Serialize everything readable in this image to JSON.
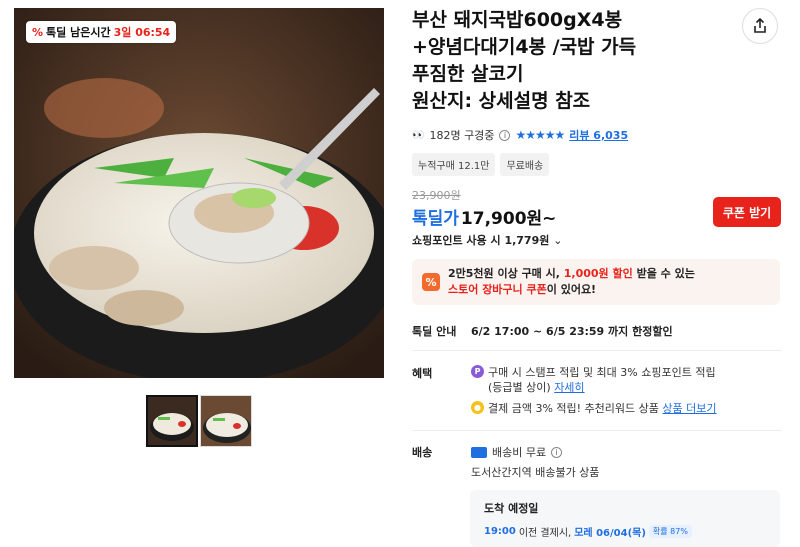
{
  "gallery": {
    "deal_tag_icon": "percent-icon",
    "deal_tag_label": "톡딜 남은시간",
    "deal_tag_time": "3일 06:54"
  },
  "product": {
    "title_lines": [
      "부산 돼지국밥600gX4봉",
      "+양념다대기4봉 /국밥 가득",
      "푸짐한 살코기",
      "원산지: 상세설명 참조"
    ],
    "viewers": "182명 구경중",
    "review_label": "리뷰 6,035",
    "rating_stars": 5,
    "chips": [
      "누적구매 12.1만",
      "무료배송"
    ],
    "original_price": "23,900원",
    "price_label": "톡딜가",
    "price": "17,900원~",
    "coupon_button": "쿠폰 받기",
    "points": "쇼핑포인트 사용 시 1,779원"
  },
  "promo": {
    "icon": "%",
    "line1_a": "2만5천원 이상 구매 시, ",
    "line1_red": "1,000원 할인",
    "line1_b": " 받을 수 있는",
    "line2_red": "스토어 장바구니 쿠폰",
    "line2_b": "이 있어요!"
  },
  "deal_info": {
    "label": "톡딜 안내",
    "value": "6/2 17:00 ~ 6/5 23:59 까지 한정할인"
  },
  "benefit": {
    "label": "혜택",
    "line1": "구매 시 스탬프 적립 및 최대 3% 쇼핑포인트 적립",
    "line1b": "(등급별 상이) ",
    "line1_link": "자세히",
    "line2": "결제 금액 3% 적립! 추천리워드 상품 ",
    "line2_link": "상품 더보기"
  },
  "shipping": {
    "label": "배송",
    "fee": "배송비 무료",
    "restriction": "도서산간지역 배송불가 상품",
    "arrival_title": "도착 예정일",
    "arrival_time": "19:00",
    "arrival_mid": " 이전 결제시, ",
    "arrival_date": "모레 06/04(목)",
    "arrival_prob": "확률 87%"
  },
  "colors": {
    "accent": "#1f6fe0",
    "deal_red": "#e8231b"
  }
}
